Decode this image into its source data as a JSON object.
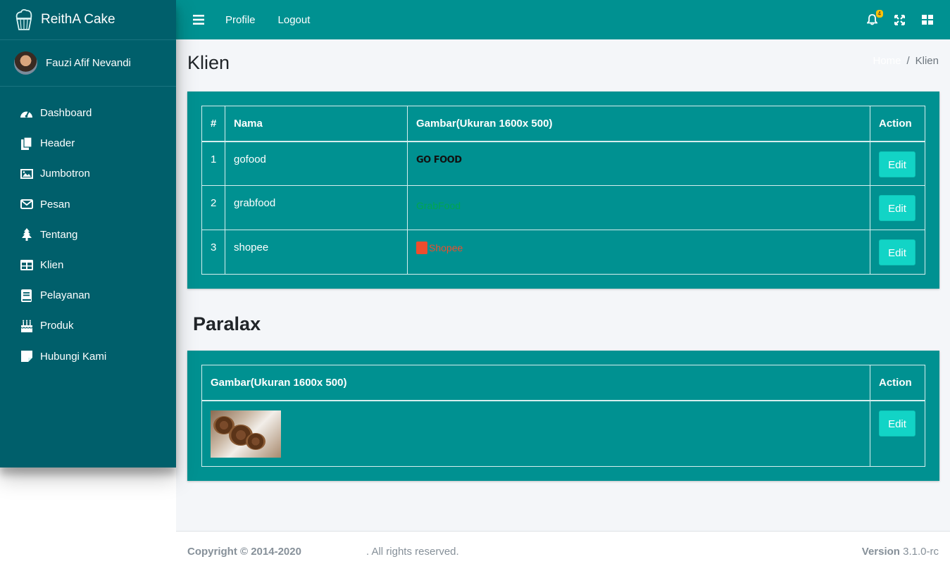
{
  "brand": {
    "name": "ReithA Cake"
  },
  "user": {
    "name": "Fauzi Afif Nevandi"
  },
  "sidebar": {
    "items": [
      {
        "label": "Dashboard",
        "icon": "tachometer-icon"
      },
      {
        "label": "Header",
        "icon": "copy-icon"
      },
      {
        "label": "Jumbotron",
        "icon": "image-icon"
      },
      {
        "label": "Pesan",
        "icon": "envelope-icon"
      },
      {
        "label": "Tentang",
        "icon": "tree-icon"
      },
      {
        "label": "Klien",
        "icon": "table-icon"
      },
      {
        "label": "Pelayanan",
        "icon": "book-icon"
      },
      {
        "label": "Produk",
        "icon": "birthday-cake-icon"
      },
      {
        "label": "Hubungi Kami",
        "icon": "sticky-note-icon"
      }
    ]
  },
  "topbar": {
    "profile": "Profile",
    "logout": "Logout",
    "notification_count": "4"
  },
  "page": {
    "title": "Klien",
    "breadcrumb_home": "Home",
    "breadcrumb_sep": "/",
    "breadcrumb_current": "Klien"
  },
  "klien_table": {
    "headers": [
      "#",
      "Nama",
      "Gambar(Ukuran 1600x 500)",
      "Action"
    ],
    "rows": [
      {
        "num": "1",
        "name": "gofood",
        "logo": "GO FOOD",
        "action": "Edit"
      },
      {
        "num": "2",
        "name": "grabfood",
        "logo": "GrabFood",
        "action": "Edit"
      },
      {
        "num": "3",
        "name": "shopee",
        "logo": "Shopee",
        "action": "Edit"
      }
    ]
  },
  "paralax": {
    "title": "Paralax",
    "headers": [
      "Gambar(Ukuran 1600x 500)",
      "Action"
    ],
    "action": "Edit"
  },
  "footer": {
    "copyright": "Copyright © 2014-2020",
    "rights": ". All rights reserved.",
    "version_label": "Version",
    "version_value": "3.1.0-rc"
  },
  "colors": {
    "sidebar": "#005f6b",
    "topbar": "#009191",
    "card": "#009191",
    "button": "#12d4c6",
    "badge": "#ffc107"
  }
}
